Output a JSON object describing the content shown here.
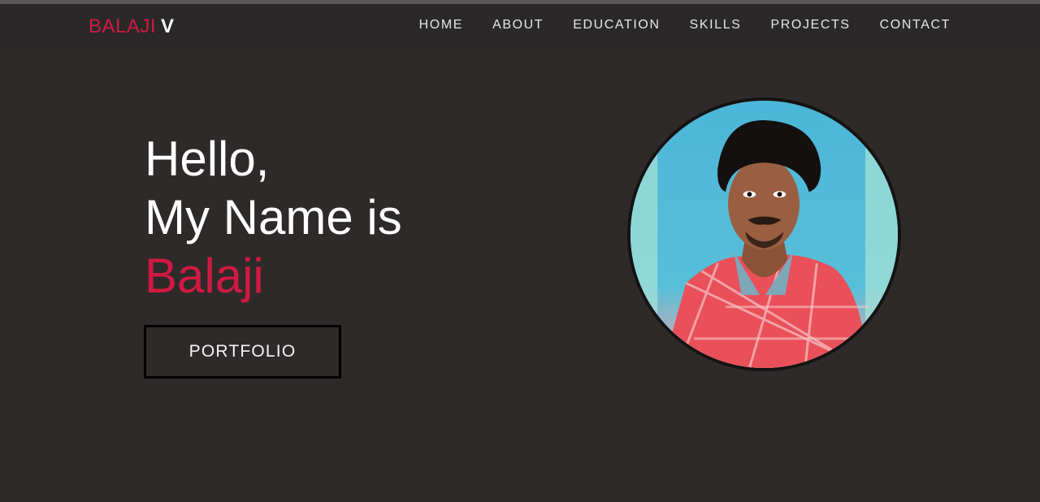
{
  "brand": {
    "first": "BALAJI",
    "last": "V",
    "accent_color": "#d01942"
  },
  "nav": {
    "items": [
      {
        "label": "HOME"
      },
      {
        "label": "ABOUT"
      },
      {
        "label": "EDUCATION"
      },
      {
        "label": "SKILLS"
      },
      {
        "label": "PROJECTS"
      },
      {
        "label": "CONTACT"
      }
    ]
  },
  "hero": {
    "greeting": "Hello,",
    "intro": "My Name is",
    "name": "Balaji",
    "button_label": "PORTFOLIO"
  },
  "colors": {
    "background": "#2e2a2a",
    "navbar": "#2a2828",
    "accent": "#d01942"
  }
}
